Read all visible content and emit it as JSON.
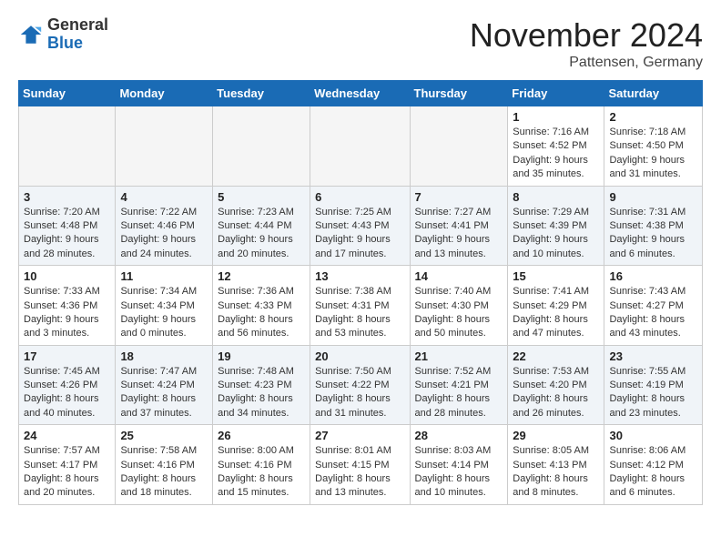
{
  "header": {
    "logo_general": "General",
    "logo_blue": "Blue",
    "month_title": "November 2024",
    "location": "Pattensen, Germany"
  },
  "days_of_week": [
    "Sunday",
    "Monday",
    "Tuesday",
    "Wednesday",
    "Thursday",
    "Friday",
    "Saturday"
  ],
  "weeks": [
    [
      {
        "day": "",
        "info": ""
      },
      {
        "day": "",
        "info": ""
      },
      {
        "day": "",
        "info": ""
      },
      {
        "day": "",
        "info": ""
      },
      {
        "day": "",
        "info": ""
      },
      {
        "day": "1",
        "info": "Sunrise: 7:16 AM\nSunset: 4:52 PM\nDaylight: 9 hours and 35 minutes."
      },
      {
        "day": "2",
        "info": "Sunrise: 7:18 AM\nSunset: 4:50 PM\nDaylight: 9 hours and 31 minutes."
      }
    ],
    [
      {
        "day": "3",
        "info": "Sunrise: 7:20 AM\nSunset: 4:48 PM\nDaylight: 9 hours and 28 minutes."
      },
      {
        "day": "4",
        "info": "Sunrise: 7:22 AM\nSunset: 4:46 PM\nDaylight: 9 hours and 24 minutes."
      },
      {
        "day": "5",
        "info": "Sunrise: 7:23 AM\nSunset: 4:44 PM\nDaylight: 9 hours and 20 minutes."
      },
      {
        "day": "6",
        "info": "Sunrise: 7:25 AM\nSunset: 4:43 PM\nDaylight: 9 hours and 17 minutes."
      },
      {
        "day": "7",
        "info": "Sunrise: 7:27 AM\nSunset: 4:41 PM\nDaylight: 9 hours and 13 minutes."
      },
      {
        "day": "8",
        "info": "Sunrise: 7:29 AM\nSunset: 4:39 PM\nDaylight: 9 hours and 10 minutes."
      },
      {
        "day": "9",
        "info": "Sunrise: 7:31 AM\nSunset: 4:38 PM\nDaylight: 9 hours and 6 minutes."
      }
    ],
    [
      {
        "day": "10",
        "info": "Sunrise: 7:33 AM\nSunset: 4:36 PM\nDaylight: 9 hours and 3 minutes."
      },
      {
        "day": "11",
        "info": "Sunrise: 7:34 AM\nSunset: 4:34 PM\nDaylight: 9 hours and 0 minutes."
      },
      {
        "day": "12",
        "info": "Sunrise: 7:36 AM\nSunset: 4:33 PM\nDaylight: 8 hours and 56 minutes."
      },
      {
        "day": "13",
        "info": "Sunrise: 7:38 AM\nSunset: 4:31 PM\nDaylight: 8 hours and 53 minutes."
      },
      {
        "day": "14",
        "info": "Sunrise: 7:40 AM\nSunset: 4:30 PM\nDaylight: 8 hours and 50 minutes."
      },
      {
        "day": "15",
        "info": "Sunrise: 7:41 AM\nSunset: 4:29 PM\nDaylight: 8 hours and 47 minutes."
      },
      {
        "day": "16",
        "info": "Sunrise: 7:43 AM\nSunset: 4:27 PM\nDaylight: 8 hours and 43 minutes."
      }
    ],
    [
      {
        "day": "17",
        "info": "Sunrise: 7:45 AM\nSunset: 4:26 PM\nDaylight: 8 hours and 40 minutes."
      },
      {
        "day": "18",
        "info": "Sunrise: 7:47 AM\nSunset: 4:24 PM\nDaylight: 8 hours and 37 minutes."
      },
      {
        "day": "19",
        "info": "Sunrise: 7:48 AM\nSunset: 4:23 PM\nDaylight: 8 hours and 34 minutes."
      },
      {
        "day": "20",
        "info": "Sunrise: 7:50 AM\nSunset: 4:22 PM\nDaylight: 8 hours and 31 minutes."
      },
      {
        "day": "21",
        "info": "Sunrise: 7:52 AM\nSunset: 4:21 PM\nDaylight: 8 hours and 28 minutes."
      },
      {
        "day": "22",
        "info": "Sunrise: 7:53 AM\nSunset: 4:20 PM\nDaylight: 8 hours and 26 minutes."
      },
      {
        "day": "23",
        "info": "Sunrise: 7:55 AM\nSunset: 4:19 PM\nDaylight: 8 hours and 23 minutes."
      }
    ],
    [
      {
        "day": "24",
        "info": "Sunrise: 7:57 AM\nSunset: 4:17 PM\nDaylight: 8 hours and 20 minutes."
      },
      {
        "day": "25",
        "info": "Sunrise: 7:58 AM\nSunset: 4:16 PM\nDaylight: 8 hours and 18 minutes."
      },
      {
        "day": "26",
        "info": "Sunrise: 8:00 AM\nSunset: 4:16 PM\nDaylight: 8 hours and 15 minutes."
      },
      {
        "day": "27",
        "info": "Sunrise: 8:01 AM\nSunset: 4:15 PM\nDaylight: 8 hours and 13 minutes."
      },
      {
        "day": "28",
        "info": "Sunrise: 8:03 AM\nSunset: 4:14 PM\nDaylight: 8 hours and 10 minutes."
      },
      {
        "day": "29",
        "info": "Sunrise: 8:05 AM\nSunset: 4:13 PM\nDaylight: 8 hours and 8 minutes."
      },
      {
        "day": "30",
        "info": "Sunrise: 8:06 AM\nSunset: 4:12 PM\nDaylight: 8 hours and 6 minutes."
      }
    ]
  ]
}
